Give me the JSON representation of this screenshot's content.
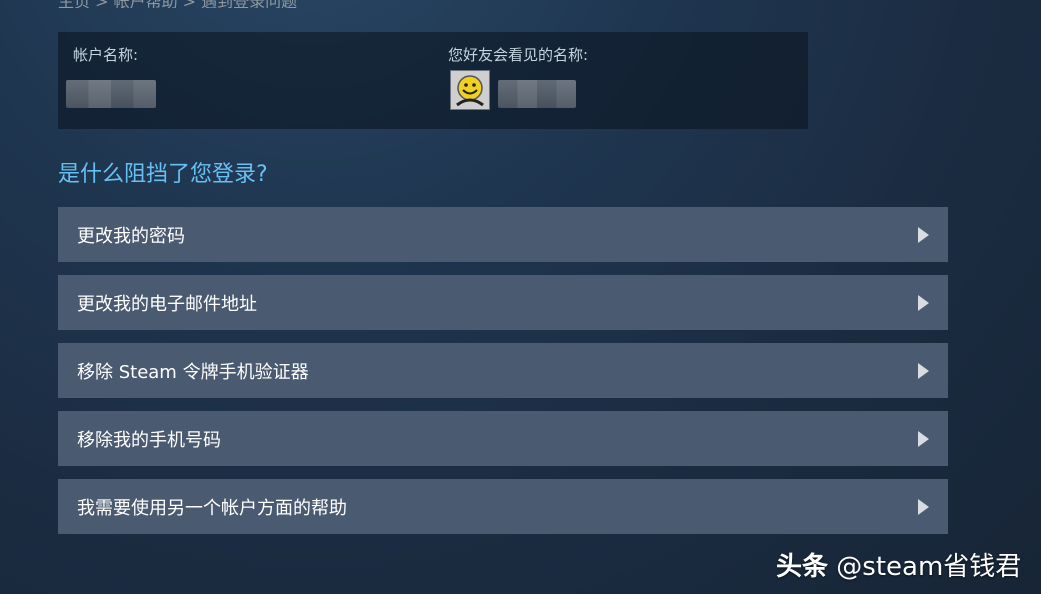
{
  "breadcrumb": {
    "text": "主页 > 帐户帮助 > 遇到登录问题"
  },
  "account": {
    "account_name_label": "帐户名称:",
    "friends_name_label": "您好友会看见的名称:",
    "account_name_value": "",
    "friends_name_value": ""
  },
  "question": {
    "title": "是什么阻挡了您登录?"
  },
  "options": [
    {
      "label": "更改我的密码",
      "icon": "triangle-right-icon"
    },
    {
      "label": "更改我的电子邮件地址",
      "icon": "triangle-right-icon"
    },
    {
      "label": "移除 Steam 令牌手机验证器",
      "icon": "triangle-right-icon"
    },
    {
      "label": "移除我的手机号码",
      "icon": "triangle-right-icon"
    },
    {
      "label": "我需要使用另一个帐户方面的帮助",
      "icon": "triangle-right-icon"
    }
  ],
  "watermark": {
    "brand": "头条",
    "handle": "@steam省钱君"
  },
  "colors": {
    "accent": "#66c0f4",
    "option_bg": "#4a5a70",
    "page_bg": "#1b2c42"
  }
}
